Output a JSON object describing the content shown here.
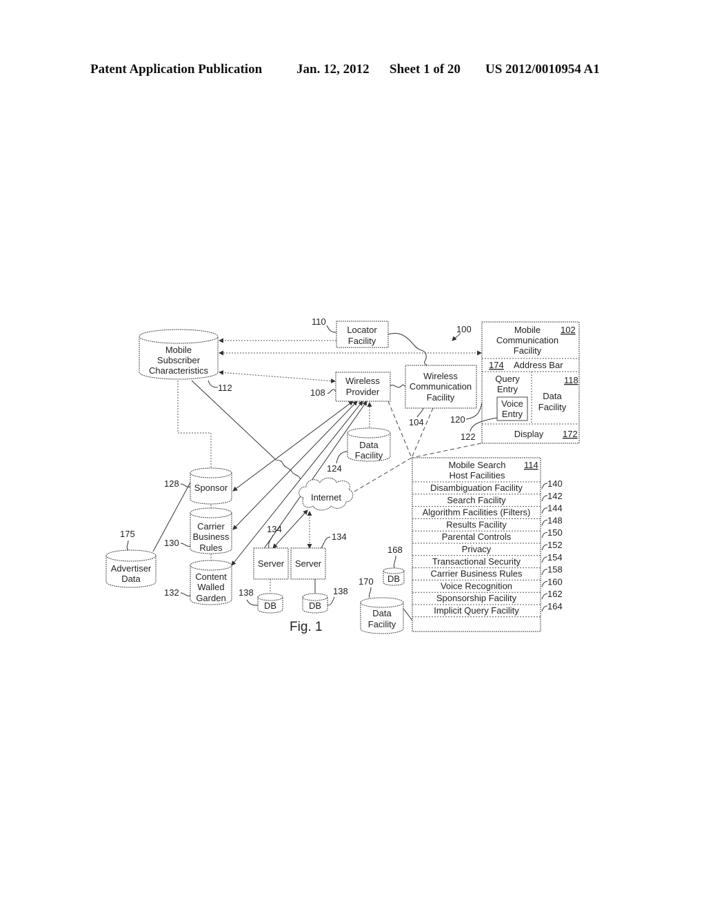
{
  "header": {
    "publication": "Patent Application Publication",
    "date": "Jan. 12, 2012",
    "sheet": "Sheet 1 of 20",
    "number": "US 2012/0010954 A1"
  },
  "figure": {
    "caption": "Fig. 1",
    "system_ref": "100",
    "nodes": {
      "mobile_subscriber": {
        "lines": [
          "Mobile",
          "Subscriber",
          "Characteristics"
        ],
        "ref": "112"
      },
      "locator": {
        "lines": [
          "Locator",
          "Facility"
        ],
        "ref": "110"
      },
      "wireless_provider": {
        "lines": [
          "Wireless",
          "Provider"
        ],
        "ref": "108"
      },
      "wireless_comm": {
        "lines": [
          "Wireless",
          "Communication",
          "Facility"
        ],
        "ref": "104"
      },
      "data_facility_124": {
        "lines": [
          "Data",
          "Facility"
        ],
        "ref": "124"
      },
      "internet": {
        "label": "Internet"
      },
      "sponsor": {
        "label": "Sponsor",
        "ref": "128"
      },
      "carrier_rules": {
        "lines": [
          "Carrier",
          "Business",
          "Rules"
        ],
        "ref": "130"
      },
      "walled_garden": {
        "lines": [
          "Content",
          "Walled",
          "Garden"
        ],
        "ref": "132"
      },
      "advertiser": {
        "lines": [
          "Advertiser",
          "Data"
        ],
        "ref": "175"
      },
      "server1": {
        "label": "Server",
        "ref": "134"
      },
      "server2": {
        "label": "Server",
        "ref": "134"
      },
      "db1": {
        "label": "DB",
        "ref": "138"
      },
      "db2": {
        "label": "DB",
        "ref": "138"
      },
      "db168": {
        "label": "DB",
        "ref": "168"
      },
      "data_facility_170": {
        "lines": [
          "Data",
          "Facility"
        ],
        "ref": "170"
      }
    },
    "mobile_comm": {
      "title_lines": [
        "Mobile",
        "Communication",
        "Facility"
      ],
      "ref": "102",
      "address_bar": {
        "ref": "174",
        "label": "Address Bar"
      },
      "query_entry": {
        "lines": [
          "Query",
          "Entry"
        ],
        "ref": "120"
      },
      "voice_entry": {
        "lines": [
          "Voice",
          "Entry"
        ],
        "ref": "122"
      },
      "data_facility": {
        "lines": [
          "Data",
          "Facility"
        ],
        "ref": "118"
      },
      "display": {
        "label": "Display",
        "ref": "172"
      }
    },
    "host": {
      "title_lines": [
        "Mobile Search",
        "Host Facilities"
      ],
      "ref": "114",
      "rows": [
        {
          "label": "Disambiguation Facility",
          "ref": "140"
        },
        {
          "label": "Search Facility",
          "ref": "142"
        },
        {
          "label": "Algorithm Facilities (Filters)",
          "ref": "144"
        },
        {
          "label": "Results Facility",
          "ref": "148"
        },
        {
          "label": "Parental Controls",
          "ref": "150"
        },
        {
          "label": "Privacy",
          "ref": "152"
        },
        {
          "label": "Transactional Security",
          "ref": "154"
        },
        {
          "label": "Carrier Business Rules",
          "ref": "158"
        },
        {
          "label": "Voice Recognition",
          "ref": "160"
        },
        {
          "label": "Sponsorship Facility",
          "ref": "162"
        },
        {
          "label": "Implicit Query Facility",
          "ref": "164"
        },
        {
          "label": "",
          "ref": ""
        }
      ]
    }
  }
}
